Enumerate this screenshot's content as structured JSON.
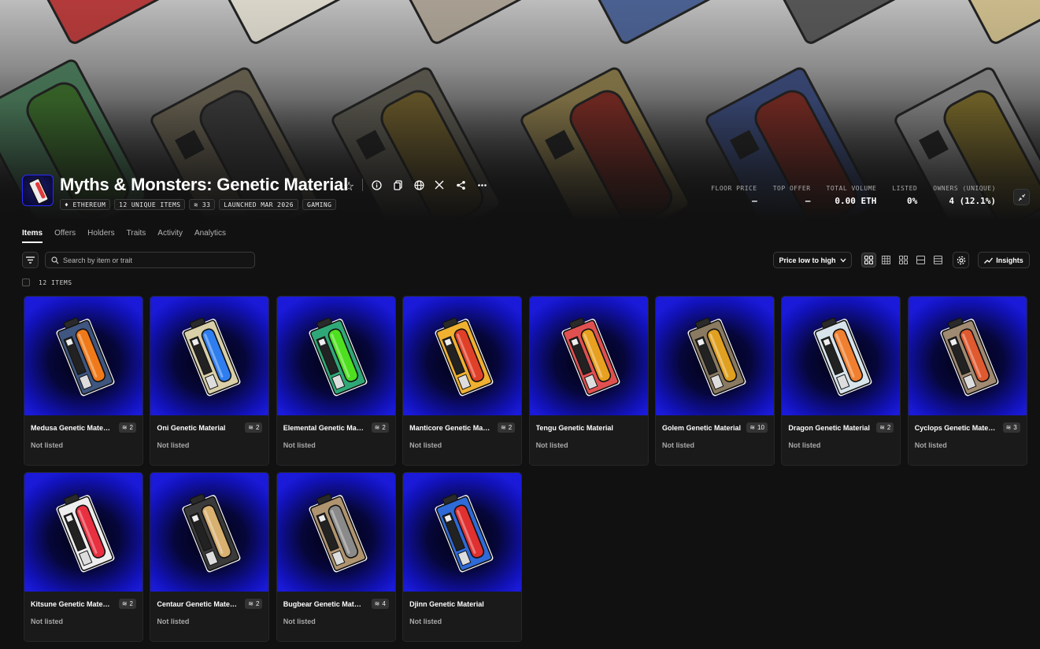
{
  "collection": {
    "title": "Myths & Monsters: Genetic Material",
    "tags": [
      "ETHEREUM",
      "12 UNIQUE ITEMS",
      "33",
      "LAUNCHED MAR 2026",
      "GAMING"
    ],
    "stats": [
      {
        "label": "FLOOR PRICE",
        "value": "–"
      },
      {
        "label": "TOP OFFER",
        "value": "–"
      },
      {
        "label": "TOTAL VOLUME",
        "value": "0.00 ETH"
      },
      {
        "label": "LISTED",
        "value": "0%"
      },
      {
        "label": "OWNERS (UNIQUE)",
        "value": "4 (12.1%)"
      }
    ]
  },
  "tabs": [
    "Items",
    "Offers",
    "Holders",
    "Traits",
    "Activity",
    "Analytics"
  ],
  "toolbar": {
    "search_placeholder": "Search by item or trait",
    "sort_label": "Price low to high",
    "insights_label": "Insights",
    "item_count": "12 ITEMS"
  },
  "items": [
    {
      "name": "Medusa Genetic Material",
      "supply": "2",
      "status": "Not listed",
      "body": "#3e5680",
      "vial": "#f07a1a"
    },
    {
      "name": "Oni Genetic Material",
      "supply": "2",
      "status": "Not listed",
      "body": "#d9cfa8",
      "vial": "#2e7ef0"
    },
    {
      "name": "Elemental Genetic Material",
      "supply": "2",
      "status": "Not listed",
      "body": "#2fa878",
      "vial": "#4ee020"
    },
    {
      "name": "Manticore Genetic Material",
      "supply": "2",
      "status": "Not listed",
      "body": "#f0b030",
      "vial": "#e04028"
    },
    {
      "name": "Tengu Genetic Material",
      "supply": "",
      "status": "Not listed",
      "body": "#e05050",
      "vial": "#e8a020"
    },
    {
      "name": "Golem Genetic Material",
      "supply": "10",
      "status": "Not listed",
      "body": "#8a7a62",
      "vial": "#e0a020"
    },
    {
      "name": "Dragon Genetic Material",
      "supply": "2",
      "status": "Not listed",
      "body": "#d8e4ec",
      "vial": "#f08030"
    },
    {
      "name": "Cyclops Genetic Material",
      "supply": "3",
      "status": "Not listed",
      "body": "#a08a72",
      "vial": "#e05a30"
    },
    {
      "name": "Kitsune Genetic Material",
      "supply": "2",
      "status": "Not listed",
      "body": "#eeeeee",
      "vial": "#e83040"
    },
    {
      "name": "Centaur Genetic Material",
      "supply": "2",
      "status": "Not listed",
      "body": "#3a3a3a",
      "vial": "#d8b070"
    },
    {
      "name": "Bugbear Genetic Material",
      "supply": "4",
      "status": "Not listed",
      "body": "#b09470",
      "vial": "#8a8a8a"
    },
    {
      "name": "Djinn Genetic Material",
      "supply": "",
      "status": "Not listed",
      "body": "#2e6ad8",
      "vial": "#e03030"
    }
  ],
  "colors": {
    "background": "#111111",
    "card_bg": "#1a1a1a",
    "card_image_edge": "#1a1ad8"
  }
}
